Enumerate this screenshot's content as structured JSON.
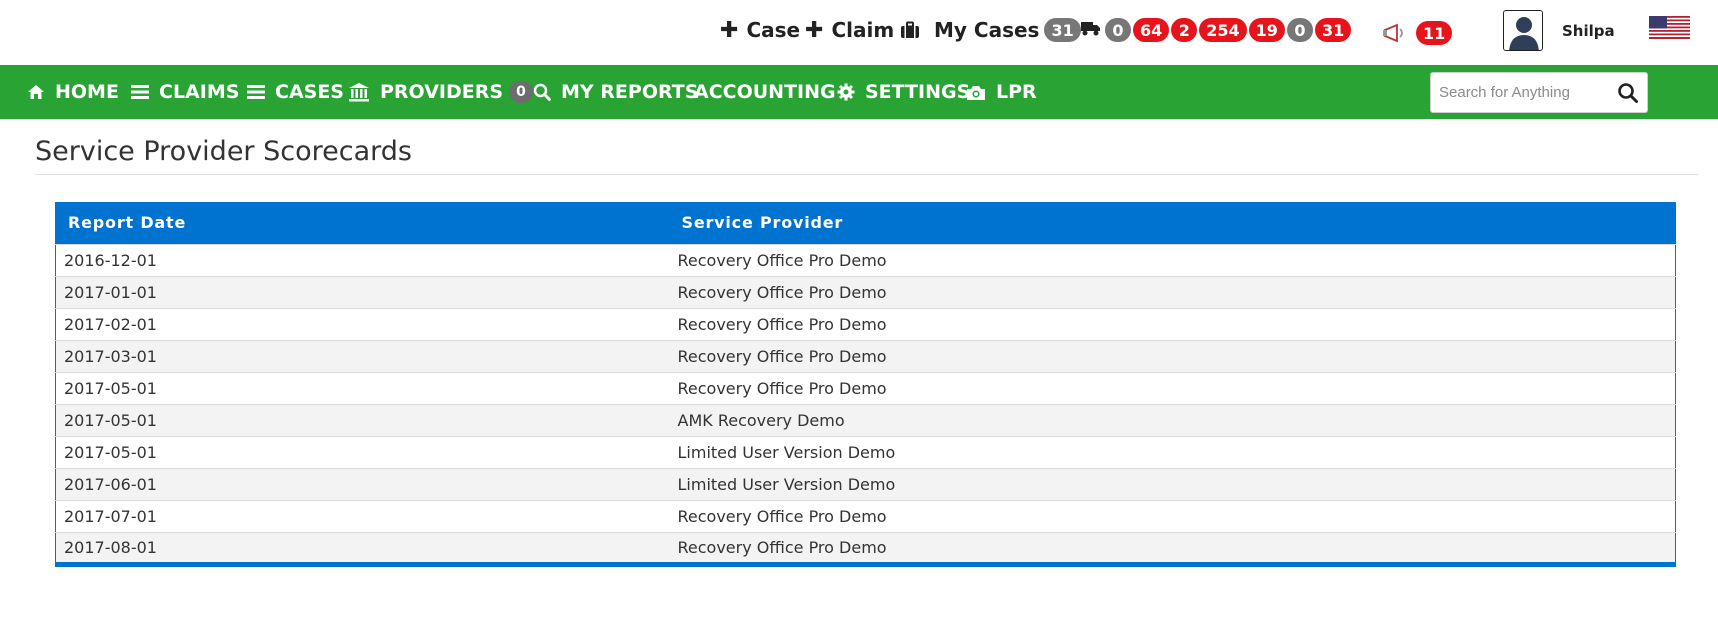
{
  "topbar": {
    "add_case_label": "Case",
    "add_claim_label": "Claim",
    "my_cases_label": "My Cases",
    "my_cases_count": "31",
    "truck_badges": [
      {
        "value": "0",
        "color": "#777777"
      },
      {
        "value": "64",
        "color": "#e8141b"
      },
      {
        "value": "2",
        "color": "#e8141b"
      },
      {
        "value": "254",
        "color": "#e8141b"
      },
      {
        "value": "19",
        "color": "#e8141b"
      },
      {
        "value": "0",
        "color": "#777777"
      },
      {
        "value": "31",
        "color": "#e8141b"
      }
    ],
    "announcements_count": "11",
    "username": "Shilpa",
    "flag_icon": "us-flag-icon"
  },
  "nav": {
    "home": "HOME",
    "claims": "CLAIMS",
    "cases": "CASES",
    "providers": "PROVIDERS",
    "providers_count": "0",
    "my_reports": "MY REPORTS",
    "accounting": "ACCOUNTING",
    "settings": "SETTINGS",
    "lpr": "LPR",
    "search_placeholder": "Search for Anything"
  },
  "page": {
    "title": "Service Provider Scorecards"
  },
  "table": {
    "headers": [
      "Report Date",
      "Service Provider"
    ],
    "rows": [
      [
        "2016-12-01",
        "Recovery Office Pro Demo"
      ],
      [
        "2017-01-01",
        "Recovery Office Pro Demo"
      ],
      [
        "2017-02-01",
        "Recovery Office Pro Demo"
      ],
      [
        "2017-03-01",
        "Recovery Office Pro Demo"
      ],
      [
        "2017-05-01",
        "Recovery Office Pro Demo"
      ],
      [
        "2017-05-01",
        "AMK Recovery Demo"
      ],
      [
        "2017-05-01",
        "Limited User Version Demo"
      ],
      [
        "2017-06-01",
        "Limited User Version Demo"
      ],
      [
        "2017-07-01",
        "Recovery Office Pro Demo"
      ],
      [
        "2017-08-01",
        "Recovery Office Pro Demo"
      ]
    ]
  },
  "colors": {
    "nav_green": "#28a334",
    "table_blue": "#0072cf",
    "badge_red": "#e8141b",
    "badge_gray": "#777777"
  }
}
